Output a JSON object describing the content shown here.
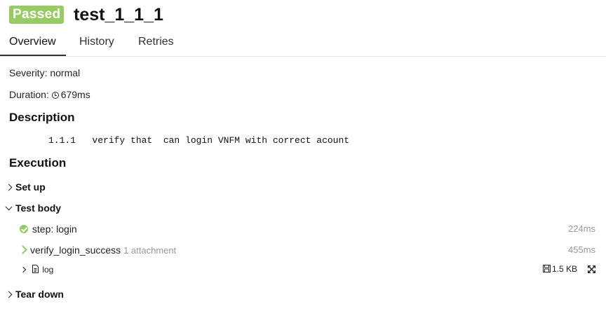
{
  "header": {
    "status": "Passed",
    "title": "test_1_1_1"
  },
  "tabs": [
    {
      "label": "Overview"
    },
    {
      "label": "History"
    },
    {
      "label": "Retries"
    }
  ],
  "overview": {
    "severity_label": "Severity:",
    "severity_value": "normal",
    "duration_label": "Duration:",
    "duration_value": "679ms",
    "description_heading": "Description",
    "description_text": "1.1.1   verify that  can login VNFM with correct acount",
    "execution_heading": "Execution",
    "setup": "Set up",
    "test_body": "Test body",
    "steps": [
      {
        "name": "step: login",
        "duration": "224ms"
      },
      {
        "name": "verify_login_success",
        "attachments": "1 attachment",
        "duration": "455ms"
      }
    ],
    "attachment": {
      "name": "log",
      "size": "1.5 KB"
    },
    "teardown": "Tear down"
  },
  "colors": {
    "passed": "#97cc64"
  }
}
